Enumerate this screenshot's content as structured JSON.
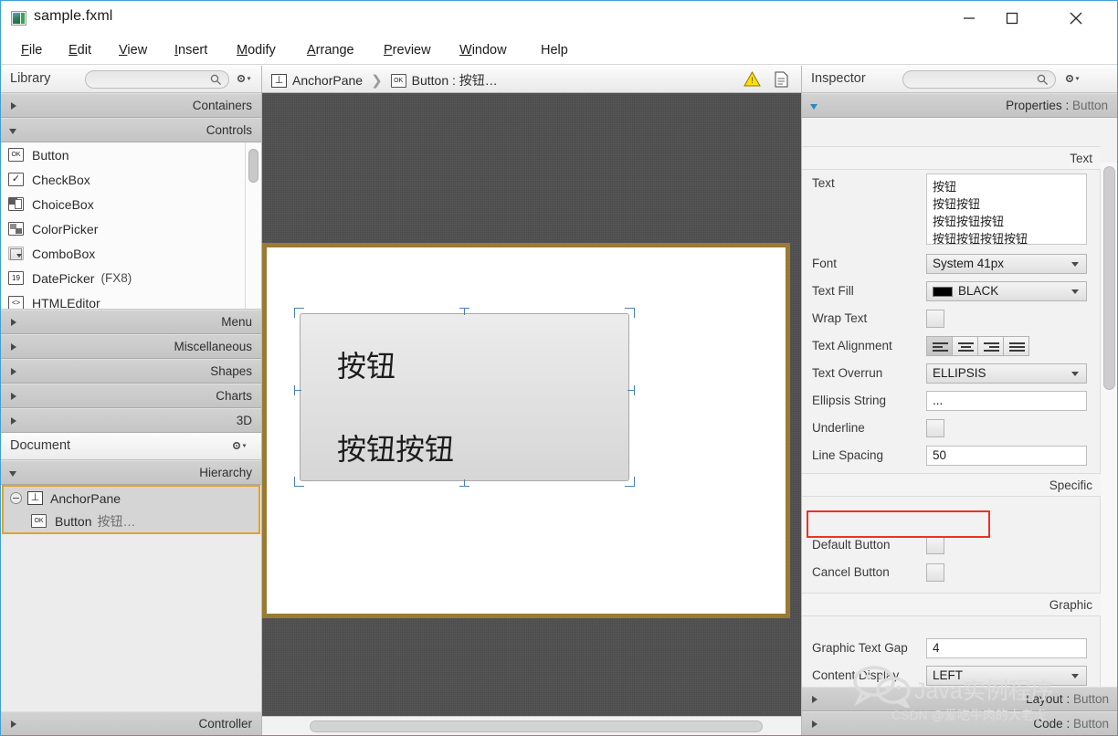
{
  "window": {
    "title": "sample.fxml",
    "icon": "fxml-file-icon",
    "controls": {
      "minimize": "–",
      "maximize": "□",
      "close": "✕"
    }
  },
  "menubar": {
    "items": [
      {
        "label": "File",
        "mnemonic": "F"
      },
      {
        "label": "Edit",
        "mnemonic": "E"
      },
      {
        "label": "View",
        "mnemonic": "V"
      },
      {
        "label": "Insert",
        "mnemonic": "I"
      },
      {
        "label": "Modify",
        "mnemonic": "M"
      },
      {
        "label": "Arrange",
        "mnemonic": "A"
      },
      {
        "label": "Preview",
        "mnemonic": "P"
      },
      {
        "label": "Window",
        "mnemonic": "W"
      },
      {
        "label": "Help",
        "mnemonic": ""
      }
    ]
  },
  "library": {
    "title": "Library",
    "search_placeholder": "",
    "search_value": "",
    "sections": [
      {
        "label": "Containers",
        "expanded": false
      },
      {
        "label": "Controls",
        "expanded": true
      },
      {
        "label": "Menu",
        "expanded": false
      },
      {
        "label": "Miscellaneous",
        "expanded": false
      },
      {
        "label": "Shapes",
        "expanded": false
      },
      {
        "label": "Charts",
        "expanded": false
      },
      {
        "label": "3D",
        "expanded": false
      }
    ],
    "controls_items": [
      {
        "label": "Button",
        "suffix": "",
        "icon": "ok-button-icon"
      },
      {
        "label": "CheckBox",
        "suffix": "",
        "icon": "checkbox-icon"
      },
      {
        "label": "ChoiceBox",
        "suffix": "",
        "icon": "choicebox-icon"
      },
      {
        "label": "ColorPicker",
        "suffix": "",
        "icon": "colorpicker-icon"
      },
      {
        "label": "ComboBox",
        "suffix": "",
        "icon": "combobox-icon"
      },
      {
        "label": "DatePicker",
        "suffix": "(FX8)",
        "icon": "datepicker-icon"
      },
      {
        "label": "HTMLEditor",
        "suffix": "",
        "icon": "htmleditor-icon"
      }
    ]
  },
  "document": {
    "title": "Document",
    "sections": [
      {
        "label": "Hierarchy",
        "expanded": true
      },
      {
        "label": "Controller",
        "expanded": false
      }
    ],
    "hierarchy": [
      {
        "label": "AnchorPane",
        "sub": "",
        "icon": "anchorpane-icon",
        "depth": 0,
        "selected": false
      },
      {
        "label": "Button",
        "sub": "按钮…",
        "icon": "ok-button-icon",
        "depth": 1,
        "selected": true
      }
    ]
  },
  "content_panel": {
    "breadcrumb": [
      {
        "label": "AnchorPane",
        "icon": "anchorpane-icon"
      },
      {
        "label": "Button : 按钮…",
        "icon": "ok-button-icon"
      }
    ],
    "warning_icon": "warning-triangle-icon",
    "doc_icon": "document-icon",
    "canvas_bg_color": "#4b4b4b",
    "stage_border_color": "#9a7b33",
    "selection_color": "#4a7fb5",
    "button_preview": {
      "text_lines": [
        "按钮",
        "按钮按钮"
      ],
      "font_size_px": 32,
      "line_spacing_px": 50
    }
  },
  "inspector": {
    "title": "Inspector",
    "search_value": "",
    "header": {
      "prefix": "Properties",
      "separator": ":",
      "target": "Button"
    },
    "groups": [
      {
        "name": "Text"
      },
      {
        "name": "Specific"
      },
      {
        "name": "Graphic"
      }
    ],
    "text_group": {
      "rows": [
        {
          "label": "Text",
          "type": "textarea",
          "value": "按钮\n按钮按钮\n按钮按钮按钮\n按钮按钮按钮按钮"
        },
        {
          "label": "Font",
          "type": "combo",
          "value": "System 41px"
        },
        {
          "label": "Text Fill",
          "type": "color",
          "value": "BLACK",
          "color": "#000000"
        },
        {
          "label": "Wrap Text",
          "type": "checkbox",
          "value": false
        },
        {
          "label": "Text Alignment",
          "type": "segmented",
          "value": "LEFT",
          "options": [
            "align-left",
            "align-center",
            "align-right",
            "align-justify"
          ]
        },
        {
          "label": "Text Overrun",
          "type": "combo",
          "value": "ELLIPSIS"
        },
        {
          "label": "Ellipsis String",
          "type": "input",
          "value": "..."
        },
        {
          "label": "Underline",
          "type": "checkbox",
          "value": false
        },
        {
          "label": "Line Spacing",
          "type": "input",
          "value": "50",
          "highlighted": true
        }
      ]
    },
    "specific_group": {
      "rows": [
        {
          "label": "Default Button",
          "type": "checkbox",
          "value": false
        },
        {
          "label": "Cancel Button",
          "type": "checkbox",
          "value": false
        }
      ]
    },
    "graphic_group": {
      "rows": [
        {
          "label": "Graphic Text Gap",
          "type": "input",
          "value": "4"
        },
        {
          "label": "Content Display",
          "type": "combo",
          "value": "LEFT"
        }
      ]
    },
    "collapsed_sections": [
      {
        "prefix": "Layout",
        "separator": ":",
        "target": "Button"
      },
      {
        "prefix": "Code",
        "separator": ":",
        "target": "Button"
      }
    ],
    "highlight_color": "#ee3124"
  },
  "watermark": {
    "line1": "Java实例程序",
    "line2": "CSDN @爱吃牛肉的大老虎",
    "logo": "wechat-icon"
  }
}
